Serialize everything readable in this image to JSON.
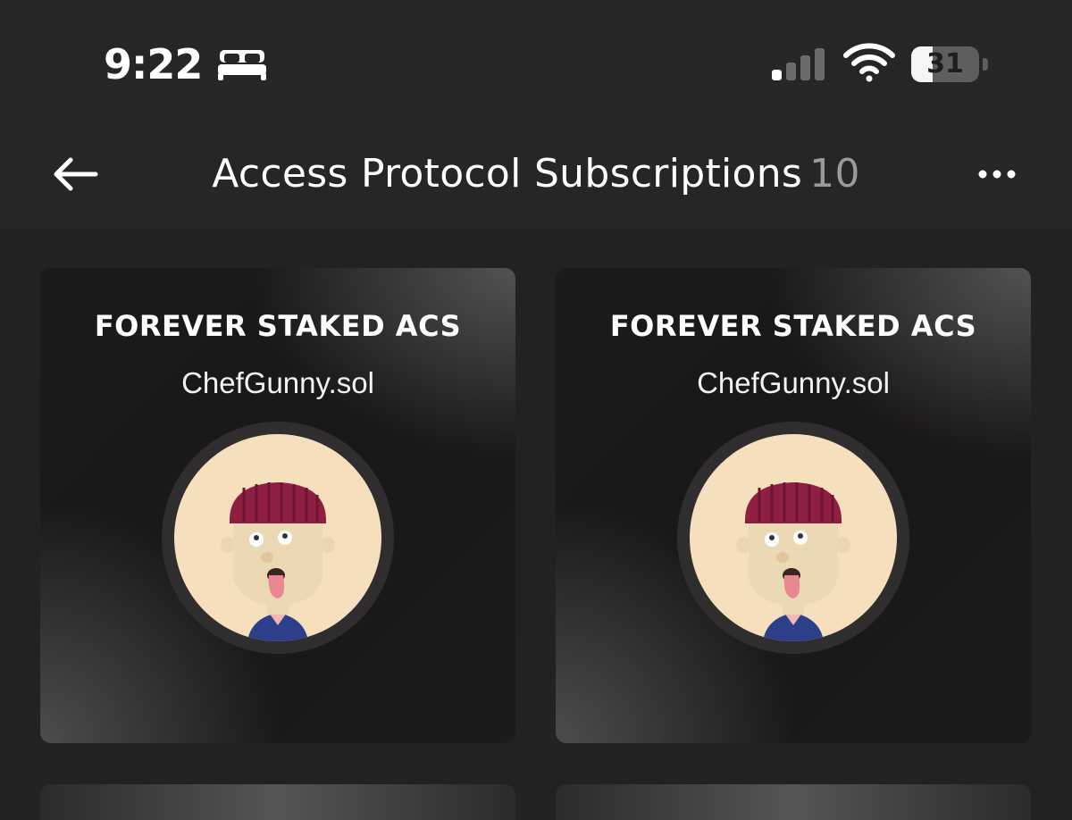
{
  "status_bar": {
    "time": "9:22",
    "battery_percent": 31,
    "battery_label": "31",
    "icons": [
      "bed-icon",
      "signal-icon",
      "wifi-icon",
      "battery-icon"
    ]
  },
  "header": {
    "title": "Access Protocol Subscriptions",
    "count": "10",
    "back_icon": "back-arrow-icon",
    "more_icon": "more-dots-icon"
  },
  "cards": [
    {
      "title": "FOREVER STAKED ACS",
      "owner": "ChefGunny.sol",
      "avatar": "avatar-image"
    },
    {
      "title": "FOREVER STAKED ACS",
      "owner": "ChefGunny.sol",
      "avatar": "avatar-image"
    }
  ],
  "colors": {
    "background": "#222222",
    "header_background": "#262626",
    "count_text": "#9a9a9a",
    "avatar_background": "#f6dfbc"
  }
}
